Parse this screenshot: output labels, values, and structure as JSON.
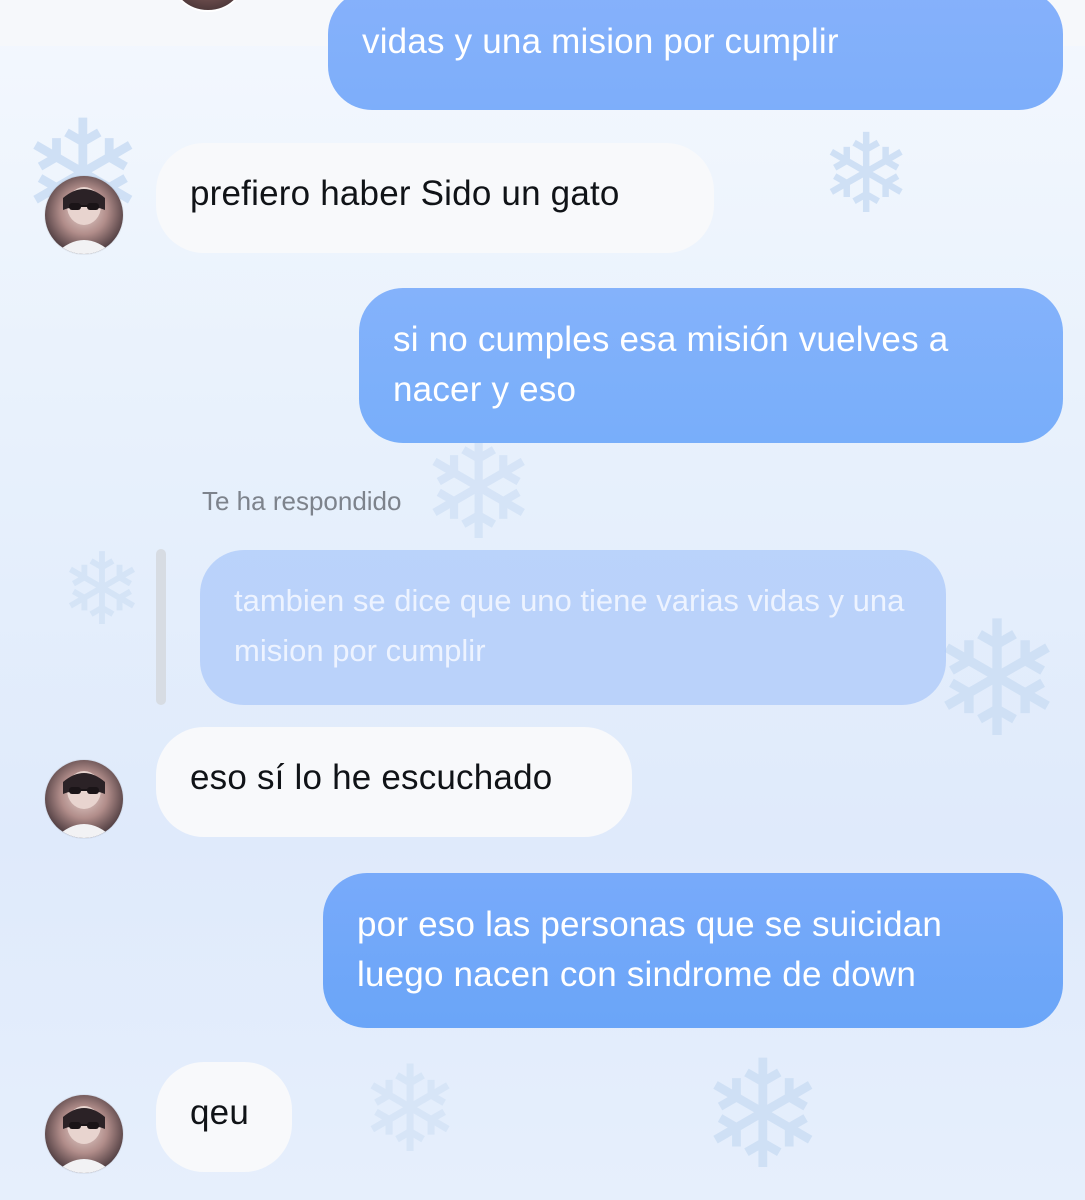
{
  "messages": [
    {
      "from": "me",
      "text": "vidas y una mision por cumplir"
    },
    {
      "from": "them",
      "text": "prefiero haber Sido un gato"
    },
    {
      "from": "me",
      "text": "si no cumples esa misión vuelves a nacer y eso"
    },
    {
      "from": "them",
      "text": "eso sí lo he escuchado"
    },
    {
      "from": "me",
      "text": "por eso las personas que se suicidan luego nacen con sindrome de down"
    },
    {
      "from": "them",
      "text": "qeu"
    }
  ],
  "reply": {
    "label": "Te ha respondido",
    "quoted_text": "tambien se dice que uno tiene varias vidas y una mision por cumplir"
  },
  "colors": {
    "outgoing_bubble": "#7daefa",
    "incoming_bubble": "#f8f9fb",
    "quoted_bubble": "#aecbfa",
    "background": "#e8f1fc"
  },
  "icons": {
    "contact_avatar": "avatar-icon",
    "background_pattern": "snowflake-icon"
  }
}
